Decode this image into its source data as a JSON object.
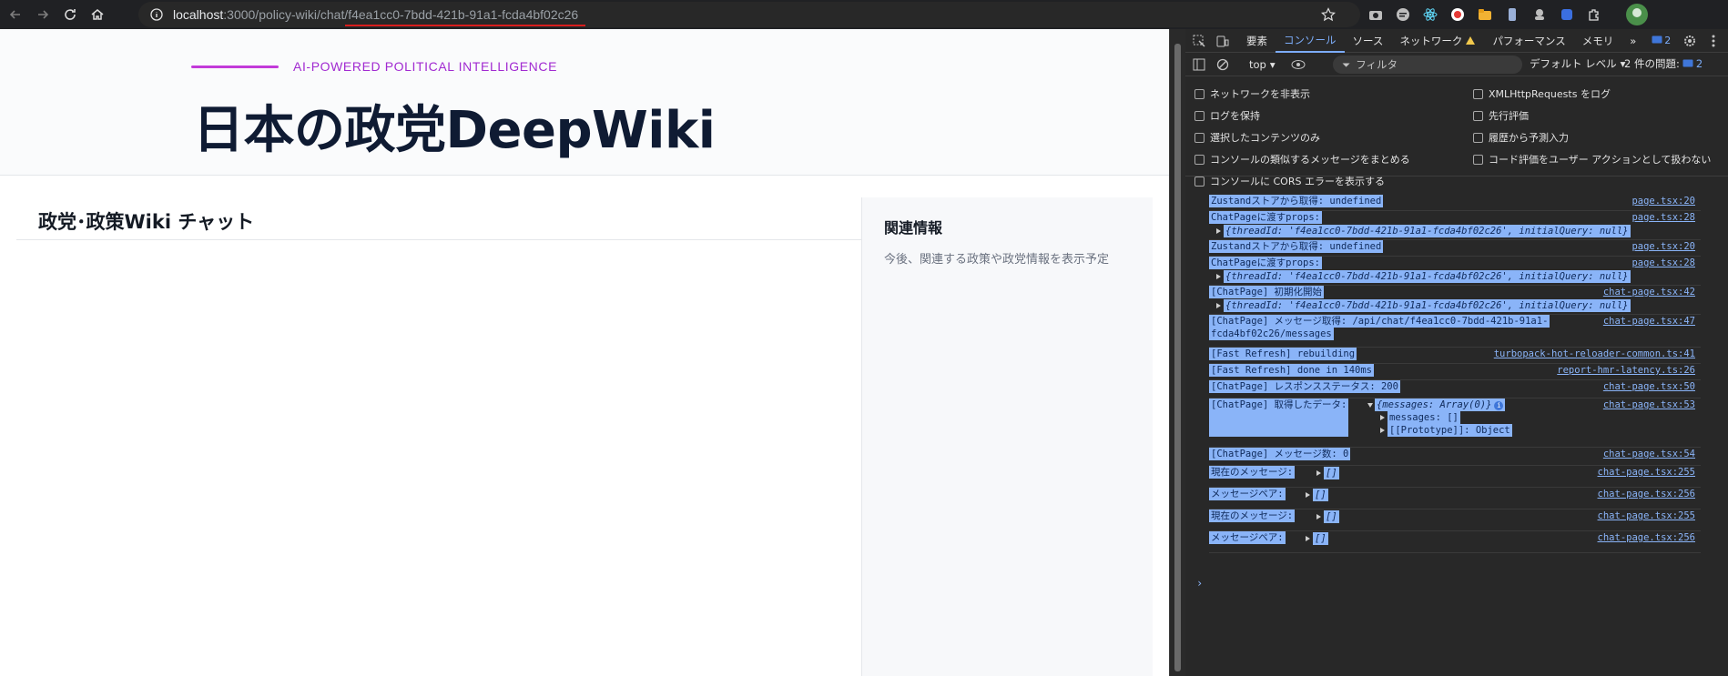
{
  "browser": {
    "url_host": "localhost",
    "url_path": ":3000/policy-wiki/chat/",
    "url_id": "f4ea1cc0-7bdd-421b-91a1-fcda4bf02c26"
  },
  "page": {
    "eyebrow": "AI-POWERED POLITICAL INTELLIGENCE",
    "title": "日本の政党DeepWiki",
    "chat_title": "政党･政策Wiki チャット",
    "side_title": "関連情報",
    "side_text": "今後、関連する政策や政党情報を表示予定"
  },
  "devtools": {
    "tabs": [
      "要素",
      "コンソール",
      "ソース",
      "ネットワーク",
      "パフォーマンス",
      "メモリ"
    ],
    "issues_badge": "2",
    "context": "top",
    "filter_placeholder": "フィルタ",
    "level": "デフォルト レベル",
    "issue_count_label": "2 件の問題:",
    "issue_count": "2",
    "options_left": [
      "ネットワークを非表示",
      "ログを保持",
      "選択したコンテンツのみ",
      "コンソールの類似するメッセージをまとめる",
      "コンソールに CORS エラーを表示する"
    ],
    "options_right": [
      "XMLHttpRequests をログ",
      "先行評価",
      "履歴から予測入力",
      "コード評価をユーザー アクションとして扱わない"
    ],
    "logs": [
      {
        "msg": "Zustandストアから取得: undefined",
        "src": "page.tsx:20"
      },
      {
        "msg": "ChatPageに渡すprops:",
        "src": "page.tsx:28",
        "obj": "{threadId: 'f4ea1cc0-7bdd-421b-91a1-fcda4bf02c26', initialQuery: null}"
      },
      {
        "msg": "Zustandストアから取得: undefined",
        "src": "page.tsx:20"
      },
      {
        "msg": "ChatPageに渡すprops:",
        "src": "page.tsx:28",
        "obj": "{threadId: 'f4ea1cc0-7bdd-421b-91a1-fcda4bf02c26', initialQuery: null}"
      },
      {
        "msg": "[ChatPage] 初期化開始",
        "src": "chat-page.tsx:42",
        "obj": "{threadId: 'f4ea1cc0-7bdd-421b-91a1-fcda4bf02c26', initialQuery: null}"
      },
      {
        "msg": "[ChatPage] メッセージ取得: /api/chat/f4ea1cc0-7bdd-421b-91a1-",
        "msg2": "fcda4bf02c26/messages",
        "src": "chat-page.tsx:47"
      },
      {
        "msg": "[Fast Refresh] rebuilding",
        "src": "turbopack-hot-reloader-common.ts:41"
      },
      {
        "msg": "[Fast Refresh] done in 140ms",
        "src": "report-hmr-latency.ts:26"
      },
      {
        "msg": "[ChatPage] レスポンスステータス: 200",
        "src": "chat-page.tsx:50"
      },
      {
        "msg": "[ChatPage] 取得したデータ:",
        "src": "chat-page.tsx:53",
        "obj": "{messages: Array(0)}",
        "child1": "messages: []",
        "child2": "[[Prototype]]: Object"
      },
      {
        "msg": "[ChatPage] メッセージ数: 0",
        "src": "chat-page.tsx:54"
      },
      {
        "msg": "現在のメッセージ:",
        "src": "chat-page.tsx:255",
        "obj": "[]"
      },
      {
        "msg": "メッセージペア:",
        "src": "chat-page.tsx:256",
        "obj": "[]"
      },
      {
        "msg": "現在のメッセージ:",
        "src": "chat-page.tsx:255",
        "obj": "[]"
      },
      {
        "msg": "メッセージペア:",
        "src": "chat-page.tsx:256",
        "obj": "[]"
      }
    ],
    "prompt": "›"
  },
  "colors": {
    "accent": "#c23ad9",
    "devtools_bg": "#282828",
    "selection": "#8ab4f8"
  }
}
